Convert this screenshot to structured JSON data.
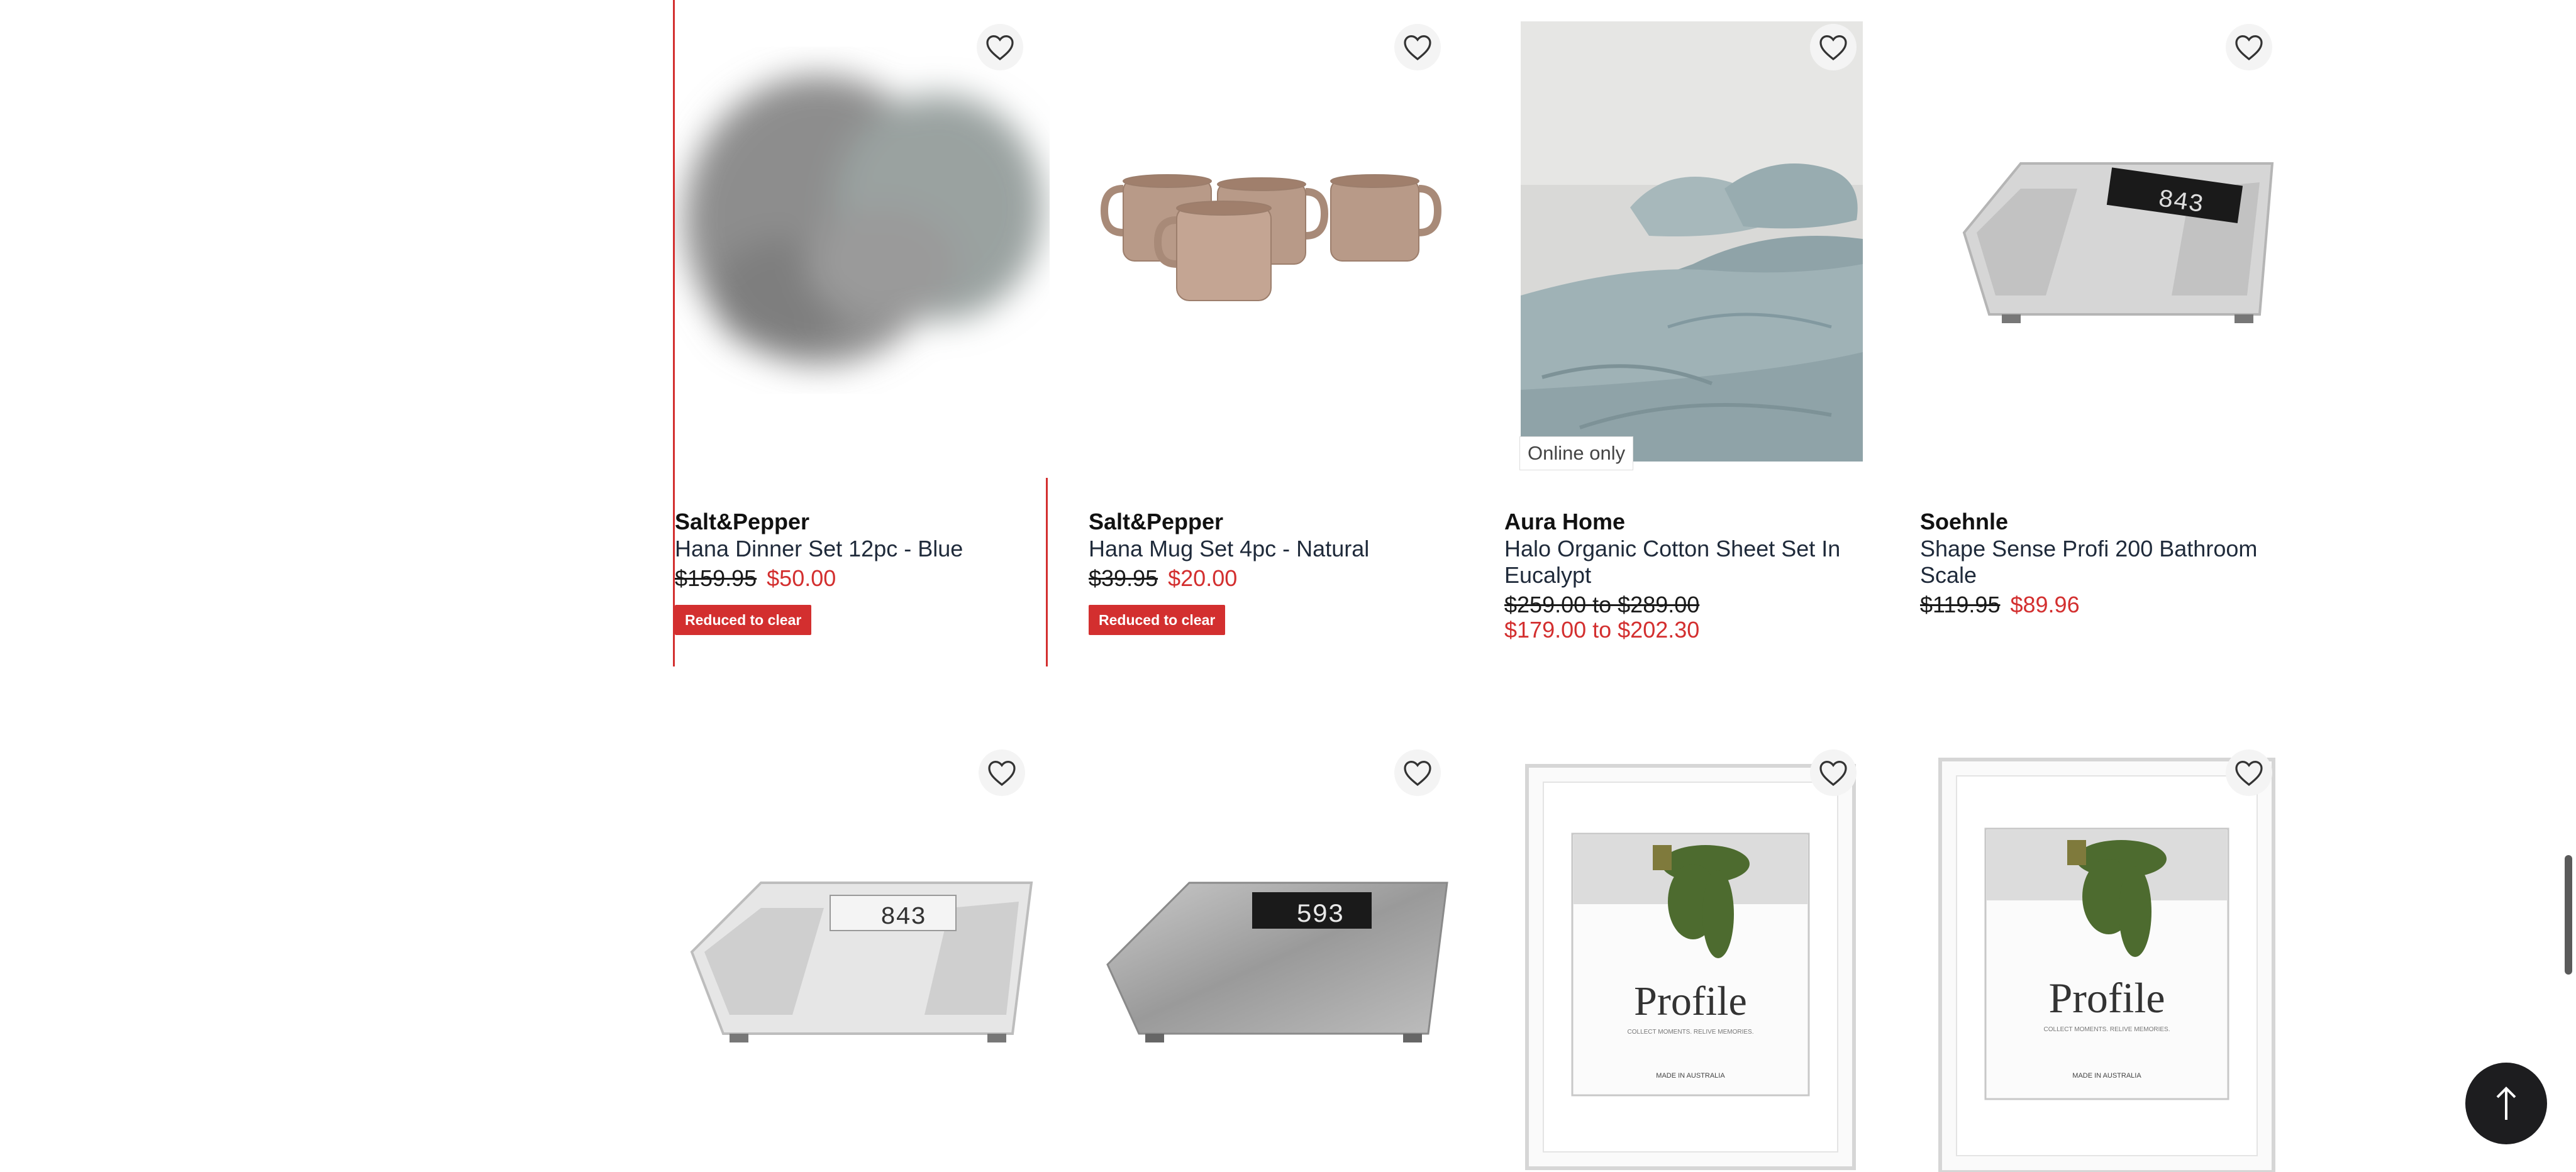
{
  "products": [
    {
      "brand": "Salt&Pepper",
      "name": "Hana Dinner Set 12pc - Blue",
      "was_price": "$159.95",
      "now_price": "$50.00",
      "badge": "Reduced to clear",
      "image": "blurred-dinner-plates-image"
    },
    {
      "brand": "Salt&Pepper",
      "name": "Hana Mug Set 4pc - Natural",
      "was_price": "$39.95",
      "now_price": "$20.00",
      "badge": "Reduced to clear",
      "image": "mug-set-image"
    },
    {
      "brand": "Aura Home",
      "name_line1": "Halo Organic Cotton Sheet Set In",
      "name_line2": "Eucalypt",
      "was_price": "$259.00 to $289.00",
      "now_price": "$179.00 to $202.30",
      "tag": "Online only",
      "image": "sheet-set-bedding-image"
    },
    {
      "brand": "Soehnle",
      "name": "Shape Sense Profi 200 Bathroom Scale",
      "was_price": "$119.95",
      "now_price": "$89.96",
      "image": "white-bathroom-scale-image"
    },
    {
      "image": "white-bathroom-scale-image",
      "display": "843"
    },
    {
      "image": "steel-bathroom-scale-image",
      "display": "593"
    },
    {
      "image": "photo-frame-image",
      "frame_text": "Profile",
      "frame_sub": "COLLECT MOMENTS. RELIVE MEMORIES.",
      "frame_foot": "MADE IN AUSTRALIA"
    },
    {
      "image": "photo-frame-image",
      "frame_text": "Profile",
      "frame_sub": "COLLECT MOMENTS. RELIVE MEMORIES.",
      "frame_foot": "MADE IN AUSTRALIA"
    }
  ],
  "scale_display_top": "843",
  "icons": {
    "wishlist": "heart-outline-icon",
    "back_to_top": "arrow-up-icon"
  },
  "colors": {
    "sale_red": "#d32f2f",
    "selection_outline": "#d32f2f",
    "back_to_top_bg": "#1d1d1f"
  }
}
